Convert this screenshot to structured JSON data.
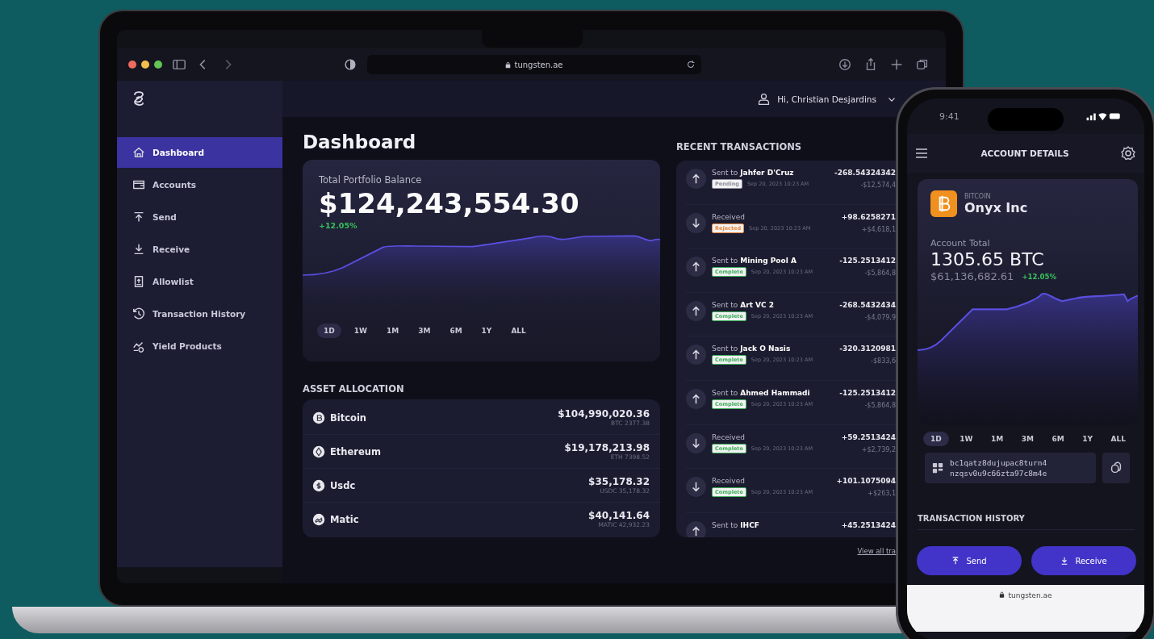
{
  "browser": {
    "url": "tungsten.ae"
  },
  "header": {
    "greeting": "Hi, Christian Desjardins"
  },
  "sidebar": {
    "items": [
      {
        "label": "Dashboard",
        "selected": true
      },
      {
        "label": "Accounts",
        "selected": false
      },
      {
        "label": "Send",
        "selected": false
      },
      {
        "label": "Receive",
        "selected": false
      },
      {
        "label": "Allowlist",
        "selected": false
      },
      {
        "label": "Transaction History",
        "selected": false
      },
      {
        "label": "Yield Products",
        "selected": false
      }
    ]
  },
  "dashboard": {
    "title": "Dashboard",
    "balance_card": {
      "label": "Total Portfolio Balance",
      "amount": "$124,243,554.30",
      "change": "+12.05%",
      "ranges": [
        {
          "label": "1D",
          "selected": true
        },
        {
          "label": "1W",
          "selected": false
        },
        {
          "label": "1M",
          "selected": false
        },
        {
          "label": "3M",
          "selected": false
        },
        {
          "label": "6M",
          "selected": false
        },
        {
          "label": "1Y",
          "selected": false
        },
        {
          "label": "ALL",
          "selected": false
        }
      ]
    },
    "asset_allocation": {
      "title": "ASSET ALLOCATION",
      "assets": [
        {
          "name": "Bitcoin",
          "value": "$104,990,020.36",
          "holding": "BTC 2377.38"
        },
        {
          "name": "Ethereum",
          "value": "$19,178,213.98",
          "holding": "ETH 7398.52"
        },
        {
          "name": "Usdc",
          "value": "$35,178.32",
          "holding": "USDC 35,178.32"
        },
        {
          "name": "Matic",
          "value": "$40,141.64",
          "holding": "MATIC 42,932.23"
        }
      ]
    }
  },
  "recent_transactions": {
    "title": "RECENT TRANSACTIONS",
    "items": [
      {
        "kind": "sent",
        "description": "Sent to **Jahfer D'Cruz**",
        "status": {
          "label": "Pending",
          "color": "#8e8e9e"
        },
        "date": "Sep 20, 2023 10:23 AM",
        "amount": "-268.54324342",
        "fiat": "-$12,574,4"
      },
      {
        "kind": "received",
        "description": "Received",
        "status": {
          "label": "Rejected",
          "color": "#e8873a"
        },
        "date": "Sep 20, 2023 10:23 AM",
        "amount": "+98.6258271",
        "fiat": "+$4,618,1"
      },
      {
        "kind": "sent",
        "description": "Sent to **Mining Pool A**",
        "status": {
          "label": "Complete",
          "color": "#3fae5a"
        },
        "date": "Sep 20, 2023 10:23 AM",
        "amount": "-125.2513412",
        "fiat": "-$5,864,8"
      },
      {
        "kind": "sent",
        "description": "Sent to **Art VC 2**",
        "status": {
          "label": "Complete",
          "color": "#3fae5a"
        },
        "date": "Sep 20, 2023 10:23 AM",
        "amount": "-268.5432434",
        "fiat": "-$4,079,9"
      },
      {
        "kind": "sent",
        "description": "Sent to **Jack O Nasis**",
        "status": {
          "label": "Complete",
          "color": "#3fae5a"
        },
        "date": "Sep 20, 2023 10:23 AM",
        "amount": "-320.3120981",
        "fiat": "-$833,6"
      },
      {
        "kind": "sent",
        "description": "Sent to **Ahmed Hammadi**",
        "status": {
          "label": "Complete",
          "color": "#3fae5a"
        },
        "date": "Sep 20, 2023 10:23 AM",
        "amount": "-125.2513412",
        "fiat": "-$5,864,8"
      },
      {
        "kind": "received",
        "description": "Received",
        "status": {
          "label": "Complete",
          "color": "#3fae5a"
        },
        "date": "Sep 20, 2023 10:23 AM",
        "amount": "+59.2513424",
        "fiat": "+$2,739,2"
      },
      {
        "kind": "received",
        "description": "Received",
        "status": {
          "label": "Complete",
          "color": "#3fae5a"
        },
        "date": "Sep 20, 2023 10:23 AM",
        "amount": "+101.1075094",
        "fiat": "+$263,1"
      },
      {
        "kind": "sent",
        "description": "Sent to **IHCF**",
        "amount": "+45.2513424"
      }
    ],
    "view_all": "View all tra"
  },
  "phone": {
    "time": "9:41",
    "title": "ACCOUNT DETAILS",
    "account": {
      "asset": "BITCOIN",
      "name": "Onyx Inc"
    },
    "total_label": "Account Total",
    "total": "1305.65 BTC",
    "fiat": "$61,136,682.61",
    "change": "+12.05%",
    "ranges": [
      {
        "label": "1D",
        "selected": true
      },
      {
        "label": "1W",
        "selected": false
      },
      {
        "label": "1M",
        "selected": false
      },
      {
        "label": "3M",
        "selected": false
      },
      {
        "label": "6M",
        "selected": false
      },
      {
        "label": "1Y",
        "selected": false
      },
      {
        "label": "ALL",
        "selected": false
      }
    ],
    "address": [
      "bc1qatz8dujupac8turn4",
      "nzqsv0u9c66zta97c8m4e"
    ],
    "history_title": "TRANSACTION HISTORY",
    "buttons": [
      {
        "kind": "send",
        "label": "Send"
      },
      {
        "kind": "receive",
        "label": "Receive"
      }
    ],
    "url": "tungsten.ae"
  }
}
